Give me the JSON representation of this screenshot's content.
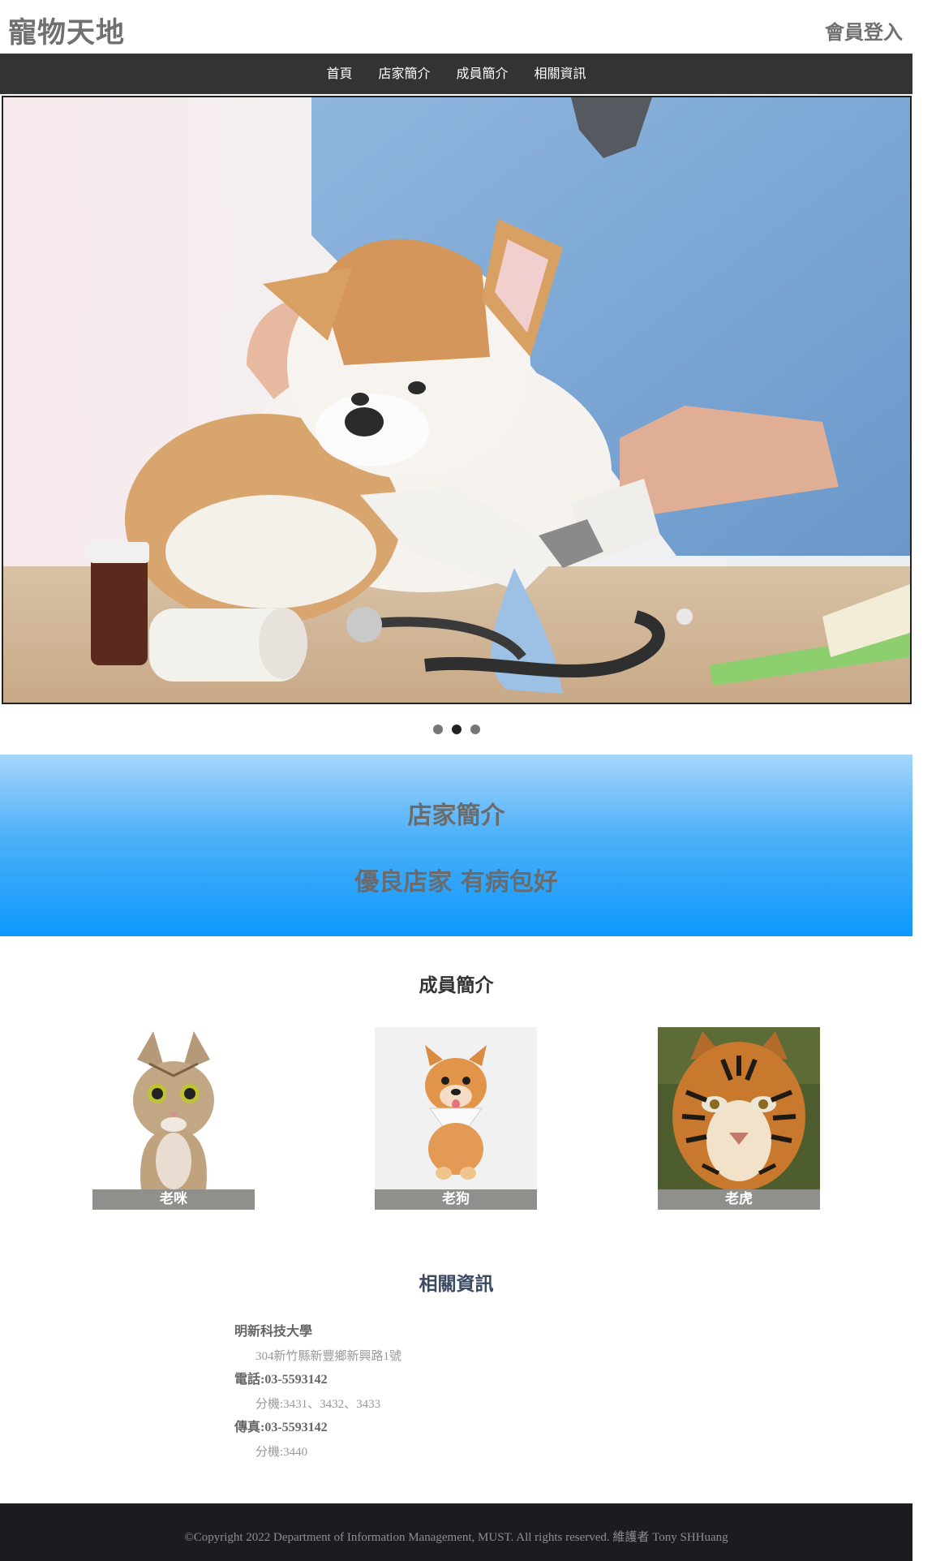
{
  "header": {
    "brand": "寵物天地",
    "login": "會員登入"
  },
  "nav": {
    "items": [
      "首頁",
      "店家簡介",
      "成員簡介",
      "相關資訊"
    ]
  },
  "carousel": {
    "slide_count": 3,
    "active_index": 1
  },
  "banner": {
    "title": "店家簡介",
    "subtitle": "優良店家 有病包好"
  },
  "members": {
    "title": "成員簡介",
    "items": [
      {
        "label": "老咪"
      },
      {
        "label": "老狗"
      },
      {
        "label": "老虎"
      }
    ]
  },
  "info": {
    "title": "相關資訊",
    "school": "明新科技大學",
    "address": "304新竹縣新豐鄉新興路1號",
    "phone": "電話:03-5593142",
    "phone_ext": "分機:3431、3432、3433",
    "fax": "傳真:03-5593142",
    "fax_ext": "分機:3440"
  },
  "footer": {
    "copyright": "©Copyright 2022 Department of Information Management, MUST. All rights reserved. 維護者 Tony SHHuang"
  }
}
